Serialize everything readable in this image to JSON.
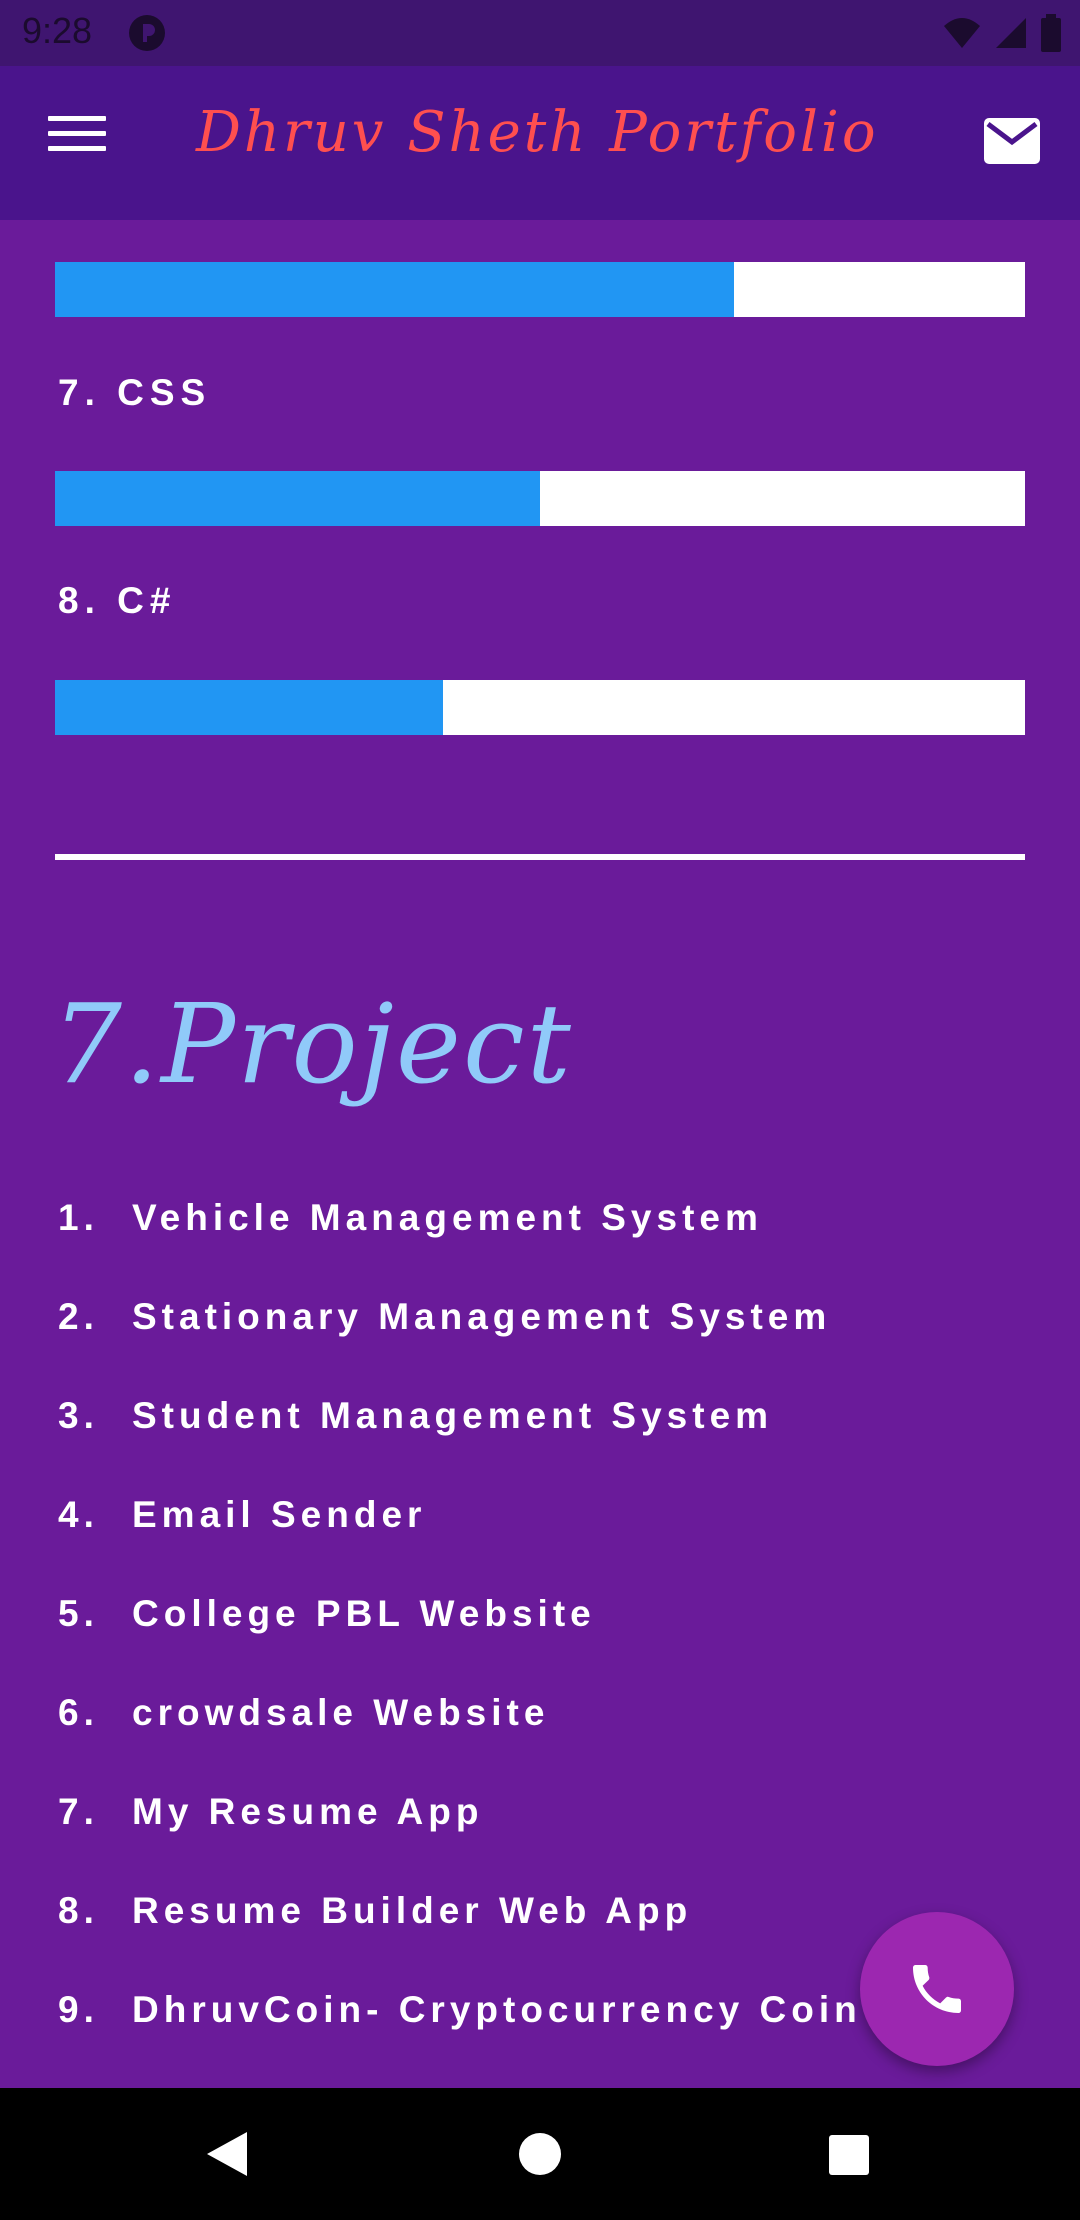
{
  "status_bar": {
    "time": "9:28"
  },
  "app_bar": {
    "title": "Dhruv Sheth Portfolio"
  },
  "skills": {
    "bar_6_level": 0.7,
    "items": [
      {
        "label": "7. CSS",
        "level": 0.5
      },
      {
        "label": "8. C#",
        "level": 0.4
      }
    ]
  },
  "projects": {
    "heading": "7.Project",
    "items": [
      {
        "num": "1.",
        "label": "Vehicle Management System"
      },
      {
        "num": "2.",
        "label": "Stationary Management System"
      },
      {
        "num": "3.",
        "label": "Student Management System"
      },
      {
        "num": "4.",
        "label": "Email Sender"
      },
      {
        "num": "5.",
        "label": "College PBL Website"
      },
      {
        "num": "6.",
        "label": "crowdsale Website"
      },
      {
        "num": "7.",
        "label": "My Resume App"
      },
      {
        "num": "8.",
        "label": "Resume Builder Web App"
      },
      {
        "num": "9.",
        "label": "DhruvCoin- Cryptocurrency Coin"
      }
    ]
  },
  "colors": {
    "background": "#6a1b9a",
    "app_bar": "#4a148c",
    "title": "#ff4f4f",
    "bar_fill": "#2196f3",
    "heading": "#90caf9",
    "fab": "#9c27b0"
  },
  "icons": {
    "menu": "menu-icon",
    "mail": "mail-icon",
    "call": "phone-icon",
    "back": "back-triangle-icon",
    "home": "home-circle-icon",
    "recents": "recents-square-icon"
  }
}
